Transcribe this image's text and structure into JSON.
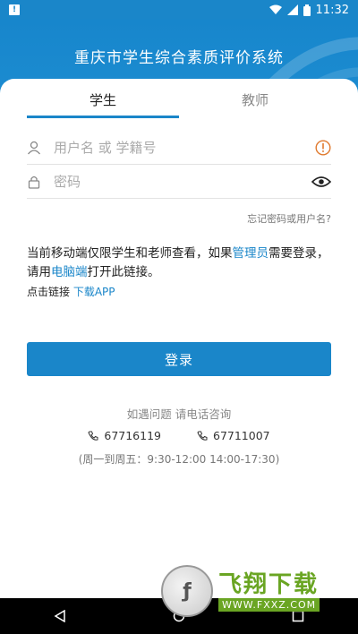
{
  "status_bar": {
    "time": "11:32"
  },
  "header": {
    "title": "重庆市学生综合素质评价系统"
  },
  "tabs": [
    {
      "label": "学生",
      "active": true
    },
    {
      "label": "教师",
      "active": false
    }
  ],
  "form": {
    "username_placeholder": "用户名 或 学籍号",
    "password_placeholder": "密码",
    "forgot_link": "忘记密码或用户名?"
  },
  "notice": {
    "part1": "当前移动端仅限学生和老师查看，如果",
    "link1": "管理员",
    "part2": "需要登录，请用",
    "link2": "电脑端",
    "part3": "打开此链接。",
    "small_prefix": "点击链接 ",
    "small_link": "下载APP"
  },
  "login_button": "登录",
  "help": {
    "text": "如遇问题 请电话咨询",
    "phones": [
      "67716119",
      "67711007"
    ],
    "hours": "(周一到周五：9:30-12:00 14:00-17:30)"
  },
  "watermark": {
    "main": "飞翔下载",
    "sub": "WWW.FXXZ.COM"
  },
  "colors": {
    "accent": "#1a86c9",
    "warning": "#e07a2f"
  }
}
